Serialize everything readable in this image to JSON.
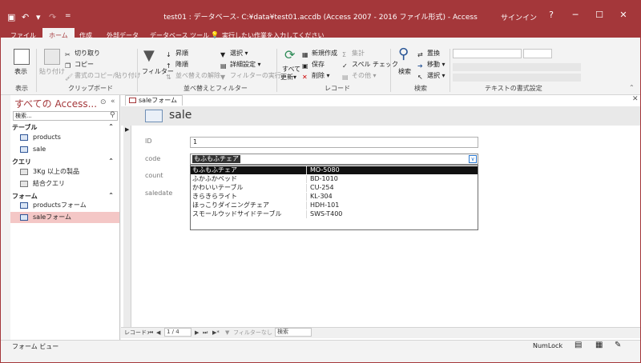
{
  "titlebar": {
    "title": "test01 : データベース- C:¥data¥test01.accdb (Access 2007 - 2016 ファイル形式) - Access",
    "signin": "サインイン",
    "help": "?",
    "minimize": "─",
    "maximize": "☐",
    "close": "✕",
    "qat_more": "="
  },
  "tabs": [
    {
      "label": "ファイル"
    },
    {
      "label": "ホーム"
    },
    {
      "label": "作成"
    },
    {
      "label": "外部データ"
    },
    {
      "label": "データベース ツール"
    },
    {
      "label": "実行したい作業を入力してください"
    }
  ],
  "ribbon": {
    "view": {
      "label": "表示",
      "group": "表示"
    },
    "clipboard": {
      "paste": "貼り付け",
      "cut": "切り取り",
      "copy": "コピー",
      "format_painter": "書式のコピー/貼り付け",
      "group": "クリップボード"
    },
    "sort_filter": {
      "filter": "フィルター",
      "asc": "昇順",
      "desc": "降順",
      "clear_sort": "並べ替えの解除",
      "selection": "選択 ▾",
      "advanced": "詳細設定 ▾",
      "toggle": "フィルターの実行",
      "group": "並べ替えとフィルター"
    },
    "records": {
      "refresh": "すべて",
      "refresh2": "更新▾",
      "new": "新規作成",
      "save": "保存",
      "delete": "削除 ▾",
      "totals": "集計",
      "spelling": "スペル チェック",
      "more": "その他 ▾",
      "group": "レコード"
    },
    "find": {
      "find": "検索",
      "replace": "置換",
      "goto": "移動 ▾",
      "select": "選択 ▾",
      "group": "検索"
    },
    "text": {
      "group": "テキストの書式設定"
    }
  },
  "nav": {
    "title": "すべての Access...",
    "search_placeholder": "検索...",
    "groups": [
      {
        "label": "テーブル",
        "items": [
          "products",
          "sale"
        ]
      },
      {
        "label": "クエリ",
        "items": [
          "3Kg 以上の製品",
          "結合クエリ"
        ]
      },
      {
        "label": "フォーム",
        "items": [
          "productsフォーム",
          "saleフォーム"
        ]
      }
    ]
  },
  "document": {
    "tab": "saleフォーム",
    "form_title": "sale",
    "fields": {
      "id_label": "ID",
      "id_value": "1",
      "code_label": "code",
      "code_value": "もふもふチェア",
      "count_label": "count",
      "saledate_label": "saledate"
    },
    "dropdown": [
      [
        "もふもふチェア",
        "MO-5080"
      ],
      [
        "ふかふかベッド",
        "BD-1010"
      ],
      [
        "かわいいテーブル",
        "CU-254"
      ],
      [
        "きらきらライト",
        "KL-304"
      ],
      [
        "ほっこりダイニングチェア",
        "HDH-101"
      ],
      [
        "スモールウッドサイドテーブル",
        "SWS-T400"
      ]
    ],
    "record_nav": {
      "label": "レコード:",
      "position": "1 / 4",
      "filter": "フィルターなし",
      "search": "検索"
    }
  },
  "status": {
    "left": "フォーム ビュー",
    "numlock": "NumLock"
  },
  "colors": {
    "accent": "#a4373a",
    "selected_nav": "#f4c7c6"
  }
}
